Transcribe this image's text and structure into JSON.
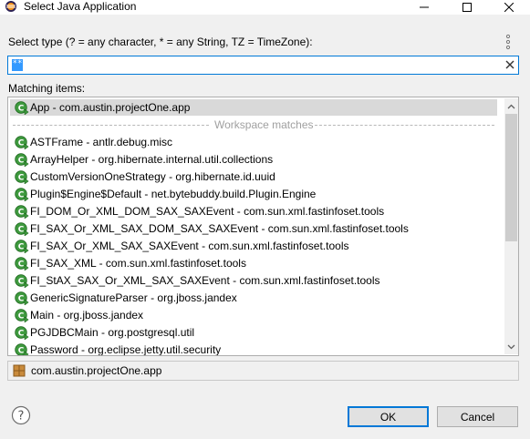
{
  "window": {
    "title": "Select Java Application",
    "controls": [
      "minimize",
      "maximize",
      "close"
    ]
  },
  "select_type_label": "Select type (? = any character, * = any String, TZ = TimeZone):",
  "search": {
    "value": "",
    "selected_token": "**",
    "placeholder": ""
  },
  "matching_label": "Matching items:",
  "history_items": [
    {
      "text": "App - com.austin.projectOne.app",
      "icon": "java-class-main-icon",
      "selected": true
    }
  ],
  "separator_label": "Workspace matches",
  "workspace_items": [
    {
      "text": "ASTFrame - antlr.debug.misc",
      "icon": "java-class-main-icon"
    },
    {
      "text": "ArrayHelper - org.hibernate.internal.util.collections",
      "icon": "java-class-main-icon"
    },
    {
      "text": "CustomVersionOneStrategy - org.hibernate.id.uuid",
      "icon": "java-class-main-icon"
    },
    {
      "text": "Plugin$Engine$Default - net.bytebuddy.build.Plugin.Engine",
      "icon": "java-class-main-icon"
    },
    {
      "text": "FI_DOM_Or_XML_DOM_SAX_SAXEvent - com.sun.xml.fastinfoset.tools",
      "icon": "java-class-main-icon"
    },
    {
      "text": "FI_SAX_Or_XML_SAX_DOM_SAX_SAXEvent - com.sun.xml.fastinfoset.tools",
      "icon": "java-class-main-icon"
    },
    {
      "text": "FI_SAX_Or_XML_SAX_SAXEvent - com.sun.xml.fastinfoset.tools",
      "icon": "java-class-main-icon"
    },
    {
      "text": "FI_SAX_XML - com.sun.xml.fastinfoset.tools",
      "icon": "java-class-main-icon"
    },
    {
      "text": "FI_StAX_SAX_Or_XML_SAX_SAXEvent - com.sun.xml.fastinfoset.tools",
      "icon": "java-class-main-icon"
    },
    {
      "text": "GenericSignatureParser - org.jboss.jandex",
      "icon": "java-class-main-icon"
    },
    {
      "text": "Main - org.jboss.jandex",
      "icon": "java-class-main-icon"
    },
    {
      "text": "PGJDBCMain - org.postgresql.util",
      "icon": "java-class-main-icon"
    },
    {
      "text": "Password - org.eclipse.jetty.util.security",
      "icon": "java-class-main-icon"
    }
  ],
  "details": {
    "icon": "package-icon",
    "text": "com.austin.projectOne.app"
  },
  "buttons": {
    "ok": "OK",
    "cancel": "Cancel"
  },
  "colors": {
    "accent": "#0078d7",
    "class_icon_green": "#3f9a3f",
    "selection": "#d9d9d9"
  }
}
